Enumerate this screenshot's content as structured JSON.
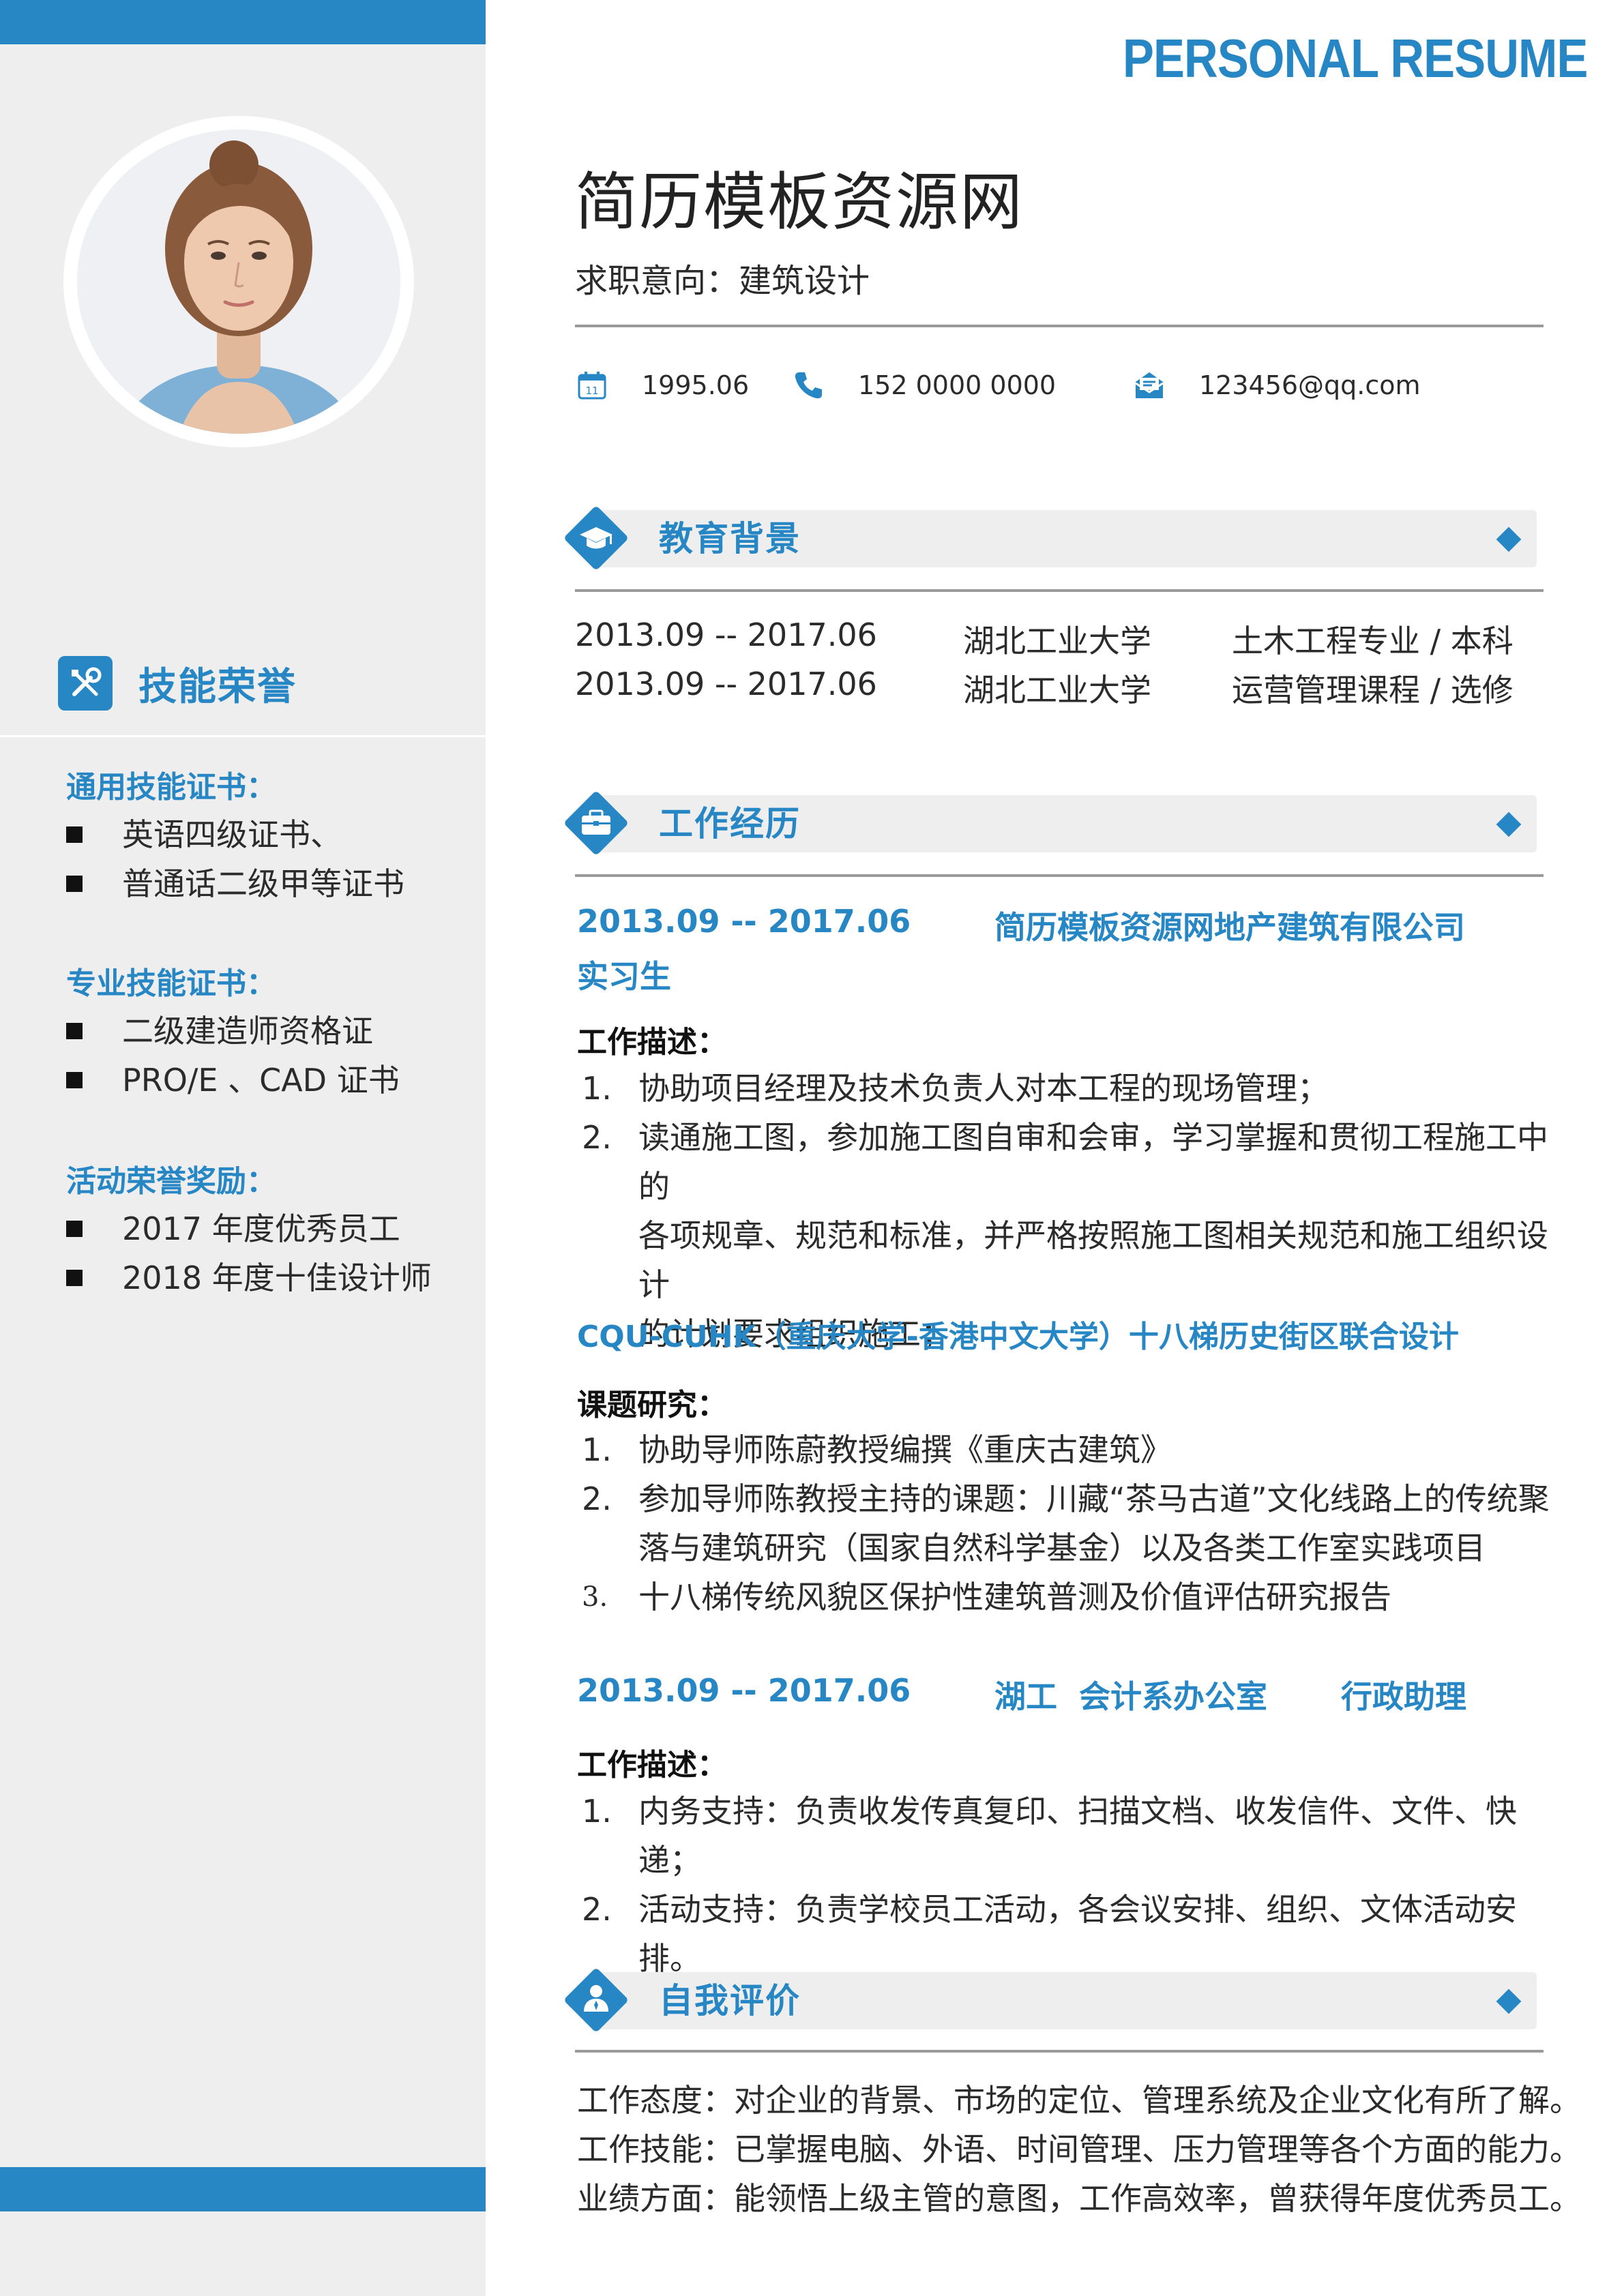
{
  "banner": "PERSONAL RESUME",
  "profile": {
    "name": "简历模板资源网",
    "intent": "求职意向：建筑设计",
    "birth": "1995.06",
    "phone": "152 0000 0000",
    "email": "123456@qq.com",
    "calendar_day": "11"
  },
  "skills": {
    "title": "技能荣誉",
    "groups": [
      {
        "title": "通用技能证书：",
        "items": [
          "英语四级证书、",
          "普通话二级甲等证书"
        ]
      },
      {
        "title": "专业技能证书：",
        "items": [
          "二级建造师资格证",
          "PRO/E 、CAD 证书"
        ]
      },
      {
        "title": "活动荣誉奖励：",
        "items": [
          "2017 年度优秀员工",
          "2018 年度十佳设计师"
        ]
      }
    ]
  },
  "education": {
    "title": "教育背景",
    "rows": [
      {
        "period": "2013.09 -- 2017.06",
        "school": "湖北工业大学",
        "major": "土木工程专业 / 本科"
      },
      {
        "period": "2013.09 -- 2017.06",
        "school": "湖北工业大学",
        "major": "运营管理课程 / 选修"
      }
    ]
  },
  "work": {
    "title": "工作经历",
    "job1": {
      "period": "2013.09 -- 2017.06",
      "company": "简历模板资源网地产建筑有限公司",
      "role": "实习生",
      "desc_label": "工作描述：",
      "items": [
        {
          "num": "1.",
          "lines": [
            "协助项目经理及技术负责人对本工程的现场管理；"
          ]
        },
        {
          "num": "2.",
          "lines": [
            "读通施工图，参加施工图自审和会审，学习掌握和贯彻工程施工中的",
            "各项规章、规范和标准，并严格按照施工图相关规范和施工组织设计",
            "的计划要求组织施工；"
          ]
        }
      ]
    },
    "project": {
      "title": "CQU-CUHK（重庆大学-香港中文大学）十八梯历史街区联合设计",
      "desc_label": "课题研究：",
      "items": [
        {
          "num": "1.",
          "lines": [
            "协助导师陈蔚教授编撰《重庆古建筑》"
          ]
        },
        {
          "num": "2.",
          "lines": [
            "参加导师陈教授主持的课题：川藏“茶马古道”文化线路上的传统聚",
            "落与建筑研究（国家自然科学基金）以及各类工作室实践项目"
          ]
        },
        {
          "num": "3.",
          "lines": [
            "十八梯传统风貌区保护性建筑普测及价值评估研究报告"
          ]
        }
      ]
    },
    "job2": {
      "period": "2013.09 -- 2017.06",
      "company": "湖工  会计系办公室",
      "role": "行政助理",
      "desc_label": "工作描述：",
      "items": [
        {
          "num": "1.",
          "lines": [
            "内务支持：负责收发传真复印、扫描文档、收发信件、文件、快递；"
          ]
        },
        {
          "num": "2.",
          "lines": [
            "活动支持：负责学校员工活动，各会议安排、组织、文体活动安排。"
          ]
        }
      ]
    }
  },
  "self_eval": {
    "title": "自我评价",
    "lines": [
      "工作态度：对企业的背景、市场的定位、管理系统及企业文化有所了解。",
      "工作技能：已掌握电脑、外语、时间管理、压力管理等各个方面的能力。",
      "业绩方面：能领悟上级主管的意图，工作高效率，曾获得年度优秀员工。"
    ]
  },
  "colors": {
    "accent": "#2786c4",
    "sidebar_bg": "#eeeeef",
    "text": "#2b2b2b"
  }
}
